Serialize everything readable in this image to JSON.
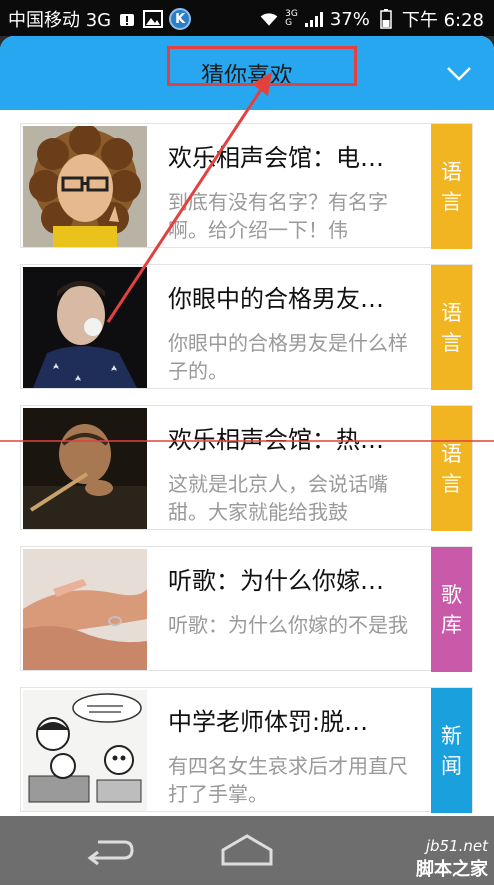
{
  "status": {
    "carrier": "中国移动 3G",
    "battery": "37%",
    "time": "下午 6:28",
    "net_top": "3G",
    "net_bottom": "G"
  },
  "header": {
    "title": "猜你喜欢"
  },
  "items": [
    {
      "title": "欢乐相声会馆：电…",
      "desc": "到底有没有名字？有名字啊。给介绍一下！伟",
      "tag_line1": "语",
      "tag_line2": "言",
      "tag_color": "#f1b521"
    },
    {
      "title": "你眼中的合格男友…",
      "desc": "你眼中的合格男友是什么样子的。",
      "tag_line1": "语",
      "tag_line2": "言",
      "tag_color": "#f1b521"
    },
    {
      "title": "欢乐相声会馆：热…",
      "desc": "这就是北京人，会说话嘴甜。大家就能给我鼓",
      "tag_line1": "语",
      "tag_line2": "言",
      "tag_color": "#f1b521"
    },
    {
      "title": "听歌：为什么你嫁…",
      "desc": "听歌：为什么你嫁的不是我",
      "tag_line1": "歌",
      "tag_line2": "库",
      "tag_color": "#c85aa9"
    },
    {
      "title": "中学老师体罚:脱…",
      "desc": "有四名女生哀求后才用直尺打了手掌。",
      "tag_line1": "新",
      "tag_line2": "闻",
      "tag_color": "#1aa0dc"
    }
  ],
  "watermark": {
    "line1": "jb51.net",
    "line2": "脚本之家"
  },
  "icons": [
    "image-icon",
    "k-app-icon",
    "wifi-icon",
    "signal-icon",
    "battery-icon",
    "chevron-down-icon",
    "back-icon",
    "home-icon"
  ]
}
